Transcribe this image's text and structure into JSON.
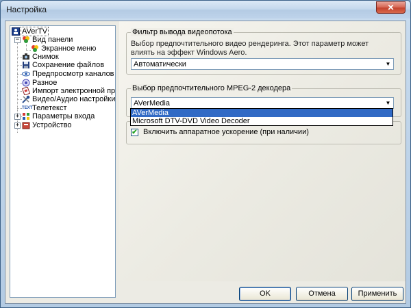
{
  "window": {
    "title": "Настройка",
    "close_glyph": "✕"
  },
  "tree": {
    "root": {
      "label": "AVerTV",
      "icon": "averTV-app-icon"
    },
    "items": [
      {
        "label": "Вид панели",
        "icon": "panel-view-icon",
        "expander": "⊟"
      },
      {
        "label": "Экранное меню",
        "icon": "osd-menu-icon"
      },
      {
        "label": "Снимок",
        "icon": "snapshot-camera-icon"
      },
      {
        "label": "Сохранение файлов",
        "icon": "save-disk-icon"
      },
      {
        "label": "Предпросмотр каналов",
        "icon": "eye-icon"
      },
      {
        "label": "Разное",
        "icon": "misc-gear-icon"
      },
      {
        "label": "Импорт электронной прог",
        "icon": "epg-import-icon"
      },
      {
        "label": "Видео/Аудио настройки",
        "icon": "tools-icon"
      },
      {
        "label": "Телетекст",
        "icon": "teletext-icon",
        "icon_text": "TEXT"
      },
      {
        "label": "Параметры входа",
        "icon": "input-params-icon",
        "expander": "+"
      },
      {
        "label": "Устройство",
        "icon": "device-icon",
        "expander": "+"
      }
    ]
  },
  "video_filter": {
    "legend": "Фильтр вывода видеопотока",
    "description": "Выбор предпочтительного видео рендеринга. Этот параметр может влиять на эффект Windows Aero.",
    "value": "Автоматически"
  },
  "mpeg_decoder": {
    "legend": "Выбор предпочтительного MPEG-2 декодера",
    "value": "AVerMedia",
    "options": [
      "AVerMedia",
      "Microsoft DTV-DVD Video Decoder"
    ],
    "highlighted_index": 0
  },
  "hw_accel": {
    "label": "Включить аппаратное ускорение (при наличии)",
    "checked": true,
    "check_glyph": "✔"
  },
  "buttons": {
    "ok": "OK",
    "cancel": "Отмена",
    "apply": "Применить"
  },
  "colors": {
    "selection": "#316ac5",
    "title_close": "#c44430"
  }
}
